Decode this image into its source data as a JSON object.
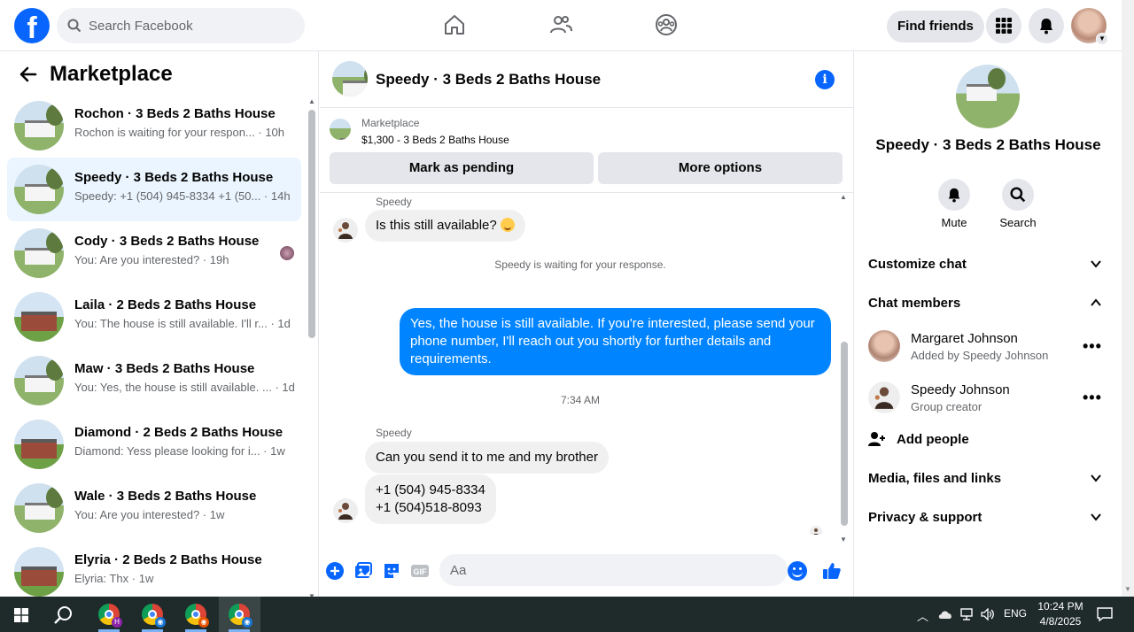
{
  "search": {
    "placeholder": "Search Facebook"
  },
  "header": {
    "find_friends": "Find friends"
  },
  "marketplace": {
    "title": "Marketplace",
    "conversations": [
      {
        "name": "Rochon · 3 Beds 2 Baths House",
        "snippet": "Rochon is waiting for your respon... · 10h",
        "house": "white",
        "active": false
      },
      {
        "name": "Speedy · 3 Beds 2 Baths House",
        "snippet": "Speedy: +1 (504) 945-8334 +1 (50... · 14h",
        "house": "white",
        "active": true
      },
      {
        "name": "Cody · 3 Beds 2 Baths House",
        "snippet": "You: Are you interested? · 19h",
        "house": "white",
        "active": false
      },
      {
        "name": "Laila · 2 Beds 2 Baths House",
        "snippet": "You: The house is still available. I'll r... · 1d",
        "house": "red",
        "active": false
      },
      {
        "name": "Maw · 3 Beds 2 Baths House",
        "snippet": "You: Yes, the house is still available. ... · 1d",
        "house": "white",
        "active": false
      },
      {
        "name": "Diamond · 2 Beds 2 Baths House",
        "snippet": "Diamond: Yess please looking for i... · 1w",
        "house": "red",
        "active": false
      },
      {
        "name": "Wale · 3 Beds 2 Baths House",
        "snippet": "You: Are you interested? · 1w",
        "house": "white",
        "active": false
      },
      {
        "name": "Elyria · 2 Beds 2 Baths House",
        "snippet": "Elyria: Thx · 1w",
        "house": "red",
        "active": false
      }
    ]
  },
  "chat": {
    "title": "Speedy · 3 Beds 2 Baths House",
    "marketplace_label": "Marketplace",
    "listing": "$1,300 - 3 Beds 2 Baths House",
    "mark_pending": "Mark as pending",
    "more_options": "More options",
    "sender1": "Speedy",
    "msg1": "Is this still available?",
    "system_note": "Speedy is waiting for your response.",
    "outgoing": "Yes, the house is still available. If you're interested, please send your phone number, I'll reach out you shortly for further details and requirements.",
    "timestamp": "7:34 AM",
    "sender2": "Speedy",
    "msg2": "Can you send it to me and my brother",
    "msg3_line1": "+1 (504) 945-8334",
    "msg3_line2": "+1 (504)518-8093",
    "composer_placeholder": "Aa"
  },
  "details": {
    "title": "Speedy · 3 Beds 2 Baths House",
    "mute": "Mute",
    "search": "Search",
    "customize_chat": "Customize chat",
    "chat_members": "Chat members",
    "members": [
      {
        "name": "Margaret Johnson",
        "sub": "Added by Speedy Johnson"
      },
      {
        "name": "Speedy Johnson",
        "sub": "Group creator"
      }
    ],
    "add_people": "Add people",
    "media": "Media, files and links",
    "privacy": "Privacy & support"
  },
  "taskbar": {
    "language": "ENG",
    "time": "10:24 PM",
    "date": "4/8/2025"
  },
  "colors": {
    "brand": "#0866ff",
    "outgoing_bubble": "#0084ff",
    "active_row": "#ebf5ff"
  }
}
